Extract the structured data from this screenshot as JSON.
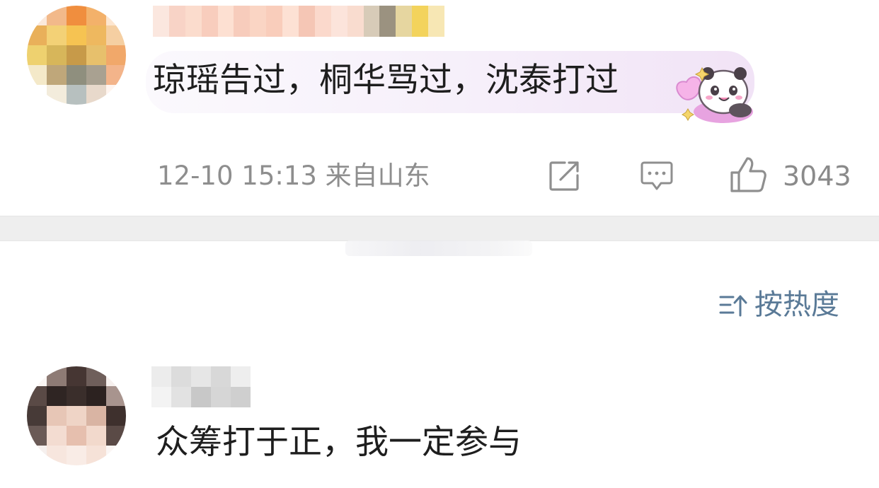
{
  "comments": [
    {
      "text": "琼瑶告过，桐华骂过，沈泰打过",
      "time_location": "12-10 15:13 来自山东",
      "likes": "3043",
      "sticker_icon": "panda-sticker-icon"
    },
    {
      "text": "众筹打于正，我一定参与"
    }
  ],
  "sort": {
    "label": "按热度",
    "icon": "sort-icon"
  },
  "actions": {
    "share_icon": "share-icon",
    "reply_icon": "reply-icon",
    "like_icon": "thumbs-up-icon"
  },
  "colors": {
    "meta_text": "#8e8e8e",
    "sort_accent": "#5a7a97",
    "bubble_tint": "#f1e3f6",
    "divider": "#eeeeee"
  }
}
